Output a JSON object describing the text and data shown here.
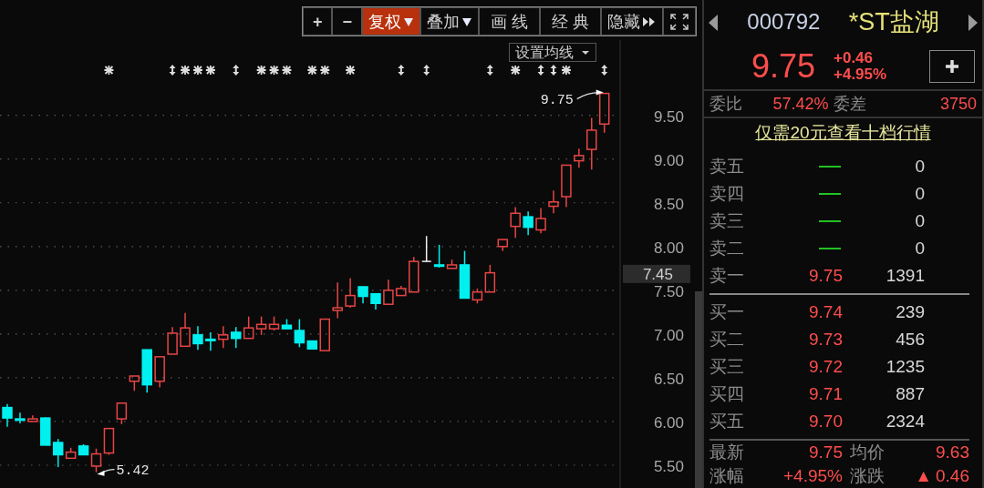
{
  "toolbar": {
    "buttons": [
      {
        "label": "+",
        "kind": "plain",
        "selected": false
      },
      {
        "label": "−",
        "kind": "plain",
        "selected": false
      },
      {
        "label": "复权",
        "kind": "dropdown",
        "selected": true
      },
      {
        "label": "叠加",
        "kind": "dropdown",
        "selected": false
      },
      {
        "label": "画 线",
        "kind": "plain",
        "selected": false
      },
      {
        "label": "经 典",
        "kind": "plain",
        "selected": false
      },
      {
        "label": "隐藏",
        "kind": "expand",
        "selected": false
      },
      {
        "kind": "fullscreen",
        "selected": false
      }
    ]
  },
  "chart": {
    "ma_setting": {
      "label": "设置均线"
    },
    "current_price": "7.45",
    "event_marks": [
      {
        "kind": "blank"
      },
      {
        "kind": "blank"
      },
      {
        "kind": "blank"
      },
      {
        "kind": "blank"
      },
      {
        "kind": "blank"
      },
      {
        "kind": "blank"
      },
      {
        "kind": "blank"
      },
      {
        "kind": "blank"
      },
      {
        "kind": "star"
      },
      {
        "kind": "blank"
      },
      {
        "kind": "blank"
      },
      {
        "kind": "blank"
      },
      {
        "kind": "blank"
      },
      {
        "kind": "arrows"
      },
      {
        "kind": "star"
      },
      {
        "kind": "star"
      },
      {
        "kind": "star"
      },
      {
        "kind": "blank"
      },
      {
        "kind": "arrows"
      },
      {
        "kind": "blank"
      },
      {
        "kind": "star"
      },
      {
        "kind": "star"
      },
      {
        "kind": "star"
      },
      {
        "kind": "blank"
      },
      {
        "kind": "star"
      },
      {
        "kind": "star"
      },
      {
        "kind": "blank"
      },
      {
        "kind": "star"
      },
      {
        "kind": "blank"
      },
      {
        "kind": "blank"
      },
      {
        "kind": "blank"
      },
      {
        "kind": "arrows"
      },
      {
        "kind": "blank"
      },
      {
        "kind": "arrows"
      },
      {
        "kind": "blank"
      },
      {
        "kind": "blank"
      },
      {
        "kind": "blank"
      },
      {
        "kind": "blank"
      },
      {
        "kind": "arrows"
      },
      {
        "kind": "blank"
      },
      {
        "kind": "star"
      },
      {
        "kind": "blank"
      },
      {
        "kind": "arrows"
      },
      {
        "kind": "arrows"
      },
      {
        "kind": "star"
      },
      {
        "kind": "blank"
      },
      {
        "kind": "blank"
      },
      {
        "kind": "arrows"
      }
    ],
    "price_labels": [
      {
        "kind": "high",
        "text": "9.75"
      },
      {
        "kind": "low",
        "text": "5.42"
      }
    ],
    "chart_data": {
      "type": "candlestick",
      "ylim": [
        5.24,
        10.36
      ],
      "grid": true,
      "yticks": [
        {
          "value": 9.5,
          "label": "9.50"
        },
        {
          "value": 9,
          "label": "9.00"
        },
        {
          "value": 8.5,
          "label": "8.50"
        },
        {
          "value": 8,
          "label": "8.00"
        },
        {
          "value": 7.5,
          "label": "7.50"
        },
        {
          "value": 7,
          "label": "7.00"
        },
        {
          "value": 6.5,
          "label": "6.50"
        },
        {
          "value": 6,
          "label": "6.00"
        },
        {
          "value": 5.5,
          "label": "5.50"
        }
      ],
      "ohlc": [
        [
          6.16,
          6.2,
          5.94,
          6.04
        ],
        [
          6.03,
          6.1,
          5.98,
          6.02
        ],
        [
          6.0,
          6.07,
          6.0,
          6.03
        ],
        [
          6.04,
          6.05,
          5.73,
          5.73
        ],
        [
          5.76,
          5.8,
          5.48,
          5.62
        ],
        [
          5.58,
          5.7,
          5.58,
          5.65
        ],
        [
          5.72,
          5.74,
          5.62,
          5.62
        ],
        [
          5.49,
          5.69,
          5.42,
          5.63
        ],
        [
          5.64,
          5.92,
          5.62,
          5.92
        ],
        [
          6.03,
          6.21,
          5.97,
          6.21
        ],
        [
          6.46,
          6.52,
          6.35,
          6.52
        ],
        [
          6.82,
          6.82,
          6.33,
          6.42
        ],
        [
          6.46,
          6.74,
          6.39,
          6.74
        ],
        [
          6.77,
          7.08,
          6.77,
          7.01
        ],
        [
          6.86,
          7.24,
          6.86,
          7.07
        ],
        [
          6.99,
          7.09,
          6.82,
          6.89
        ],
        [
          6.94,
          7.02,
          6.81,
          6.93
        ],
        [
          6.94,
          7.09,
          6.84,
          6.99
        ],
        [
          7.02,
          7.08,
          6.84,
          6.95
        ],
        [
          6.95,
          7.2,
          6.95,
          7.07
        ],
        [
          7.06,
          7.2,
          6.99,
          7.11
        ],
        [
          7.06,
          7.2,
          7.04,
          7.11
        ],
        [
          7.1,
          7.17,
          7.06,
          7.06
        ],
        [
          7.04,
          7.17,
          6.85,
          6.9
        ],
        [
          6.92,
          6.92,
          6.83,
          6.83
        ],
        [
          6.81,
          7.17,
          6.81,
          7.17
        ],
        [
          7.27,
          7.59,
          7.18,
          7.3
        ],
        [
          7.32,
          7.64,
          7.3,
          7.44
        ],
        [
          7.54,
          7.54,
          7.35,
          7.43
        ],
        [
          7.46,
          7.46,
          7.28,
          7.35
        ],
        [
          7.34,
          7.62,
          7.34,
          7.5
        ],
        [
          7.44,
          7.55,
          7.44,
          7.52
        ],
        [
          7.48,
          7.88,
          7.48,
          7.83
        ],
        [
          7.83,
          8.12,
          7.83,
          7.83
        ],
        [
          7.79,
          8.02,
          7.76,
          7.78
        ],
        [
          7.75,
          7.85,
          7.75,
          7.79
        ],
        [
          7.79,
          7.95,
          7.41,
          7.41
        ],
        [
          7.39,
          7.52,
          7.35,
          7.48
        ],
        [
          7.48,
          7.79,
          7.48,
          7.7
        ],
        [
          8.0,
          8.08,
          7.95,
          8.08
        ],
        [
          8.23,
          8.45,
          8.1,
          8.38
        ],
        [
          8.34,
          8.4,
          8.13,
          8.22
        ],
        [
          8.19,
          8.44,
          8.15,
          8.32
        ],
        [
          8.46,
          8.64,
          8.38,
          8.51
        ],
        [
          8.57,
          8.93,
          8.45,
          8.93
        ],
        [
          8.98,
          9.12,
          8.9,
          9.04
        ],
        [
          9.11,
          9.47,
          8.88,
          9.33
        ],
        [
          9.4,
          9.75,
          9.3,
          9.75
        ]
      ]
    }
  },
  "quote": {
    "code": "000792",
    "name": "*ST盐湖",
    "price": "9.75",
    "change": "+0.46",
    "change_pct": "+4.95%"
  },
  "stats": [
    {
      "label": "委比",
      "value": "57.42%"
    },
    {
      "label": "委差",
      "value": "3750"
    }
  ],
  "promo_link": "仅需20元查看十档行情",
  "asks": [
    {
      "label": "卖五",
      "kind": "empty",
      "volume": "0"
    },
    {
      "label": "卖四",
      "kind": "empty",
      "volume": "0"
    },
    {
      "label": "卖三",
      "kind": "empty",
      "volume": "0"
    },
    {
      "label": "卖二",
      "kind": "empty",
      "volume": "0"
    },
    {
      "label": "卖一",
      "kind": "filled",
      "price": "9.75",
      "volume": "1391"
    }
  ],
  "bids": [
    {
      "label": "买一",
      "kind": "filled",
      "price": "9.74",
      "volume": "239"
    },
    {
      "label": "买二",
      "kind": "filled",
      "price": "9.73",
      "volume": "456"
    },
    {
      "label": "买三",
      "kind": "filled",
      "price": "9.72",
      "volume": "1235"
    },
    {
      "label": "买四",
      "kind": "filled",
      "price": "9.71",
      "volume": "887"
    },
    {
      "label": "买五",
      "kind": "filled",
      "price": "9.70",
      "volume": "2324"
    }
  ],
  "summary": [
    {
      "label": "最新",
      "value": "9.75"
    },
    {
      "label": "均价",
      "value": "9.63"
    },
    {
      "label": "涨幅",
      "value": "+4.95%"
    },
    {
      "label": "涨跌",
      "marker": "▲",
      "value": "0.46"
    }
  ]
}
